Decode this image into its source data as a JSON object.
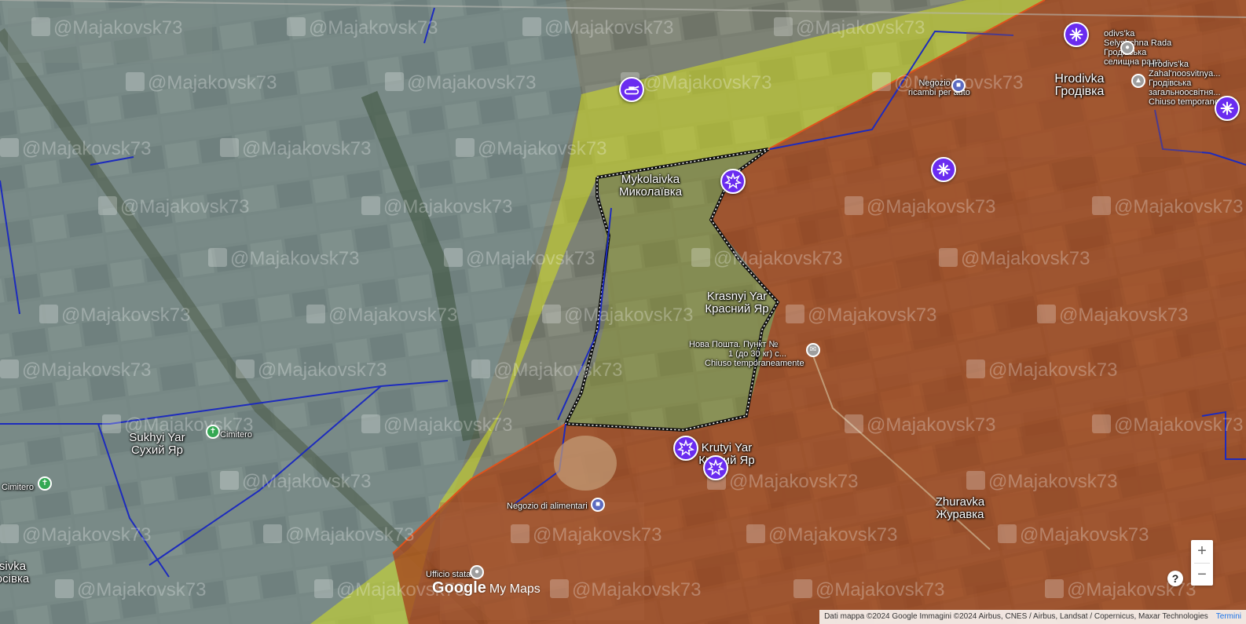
{
  "colors": {
    "occupied": "#b2471a",
    "contested": "#d4e021",
    "friendly_tint": "#6ea3b8",
    "frontline": "#111111",
    "river": "#1d2bbd",
    "marker": "#6a2cf0"
  },
  "places": {
    "mykolaivka": {
      "latin": "Mykolaivka",
      "cyrillic": "Миколаївка"
    },
    "krasnyi_yar": {
      "latin": "Krasnyi Yar",
      "cyrillic": "Красний Яр"
    },
    "krutyi_yar": {
      "latin": "Krutyi Yar",
      "cyrillic": "Крутий Яр"
    },
    "sukhyi_yar": {
      "latin": "Sukhyi Yar",
      "cyrillic": "Сухий Яр"
    },
    "zhuravka": {
      "latin": "Zhuravka",
      "cyrillic": "Журавка"
    },
    "hrodivka": {
      "latin": "Hrodivka",
      "cyrillic": "Гродівка"
    },
    "rosivka_partial": {
      "latin": "sivka",
      "cyrillic": "осівка"
    }
  },
  "pois": {
    "selyshchna": {
      "title": "odivs'ka",
      "line2": "Selyshchna Rada",
      "line3": "Гродівська",
      "line4": "селищна рада"
    },
    "zahal": {
      "title": "Hrodivs'ka",
      "line2": "Zahal'noosvitnya...",
      "line3": "Гродівська",
      "line4": "загальноосвітня...",
      "line5": "Chiuso temporane..."
    },
    "negozio_ricambi": {
      "title": "Negozio di",
      "line2": "ricambi per auto"
    },
    "nova_poshta": {
      "title": "Нова Пошта. Пункт №",
      "line2": "1 (до 30 кг) с...",
      "line3": "Chiuso temporaneamente"
    },
    "cimitero_1": {
      "title": "Cimitero"
    },
    "cimitero_2": {
      "title": "Cimitero"
    },
    "negozio_alimentari": {
      "title": "Negozio di alimentari"
    },
    "ufficio": {
      "title": "Ufficio statale"
    }
  },
  "watermark": "@Majakovsk73",
  "map_ui": {
    "zoom_in": "+",
    "zoom_out": "−",
    "help": "?",
    "logo_google": "Google",
    "logo_mymaps": "My Maps",
    "attribution": "Dati mappa ©2024 Google Immagini ©2024 Airbus, CNES / Airbus, Landsat / Copernicus, Maxar Technologies",
    "terms": "Termini"
  },
  "markers": [
    {
      "name": "drone-marker",
      "type": "drone"
    },
    {
      "name": "drone-marker",
      "type": "drone"
    },
    {
      "name": "drone-marker",
      "type": "drone"
    },
    {
      "name": "tank-marker",
      "type": "tank"
    },
    {
      "name": "explosion-marker",
      "type": "explosion"
    },
    {
      "name": "explosion-marker",
      "type": "explosion"
    },
    {
      "name": "explosion-marker",
      "type": "explosion"
    }
  ]
}
